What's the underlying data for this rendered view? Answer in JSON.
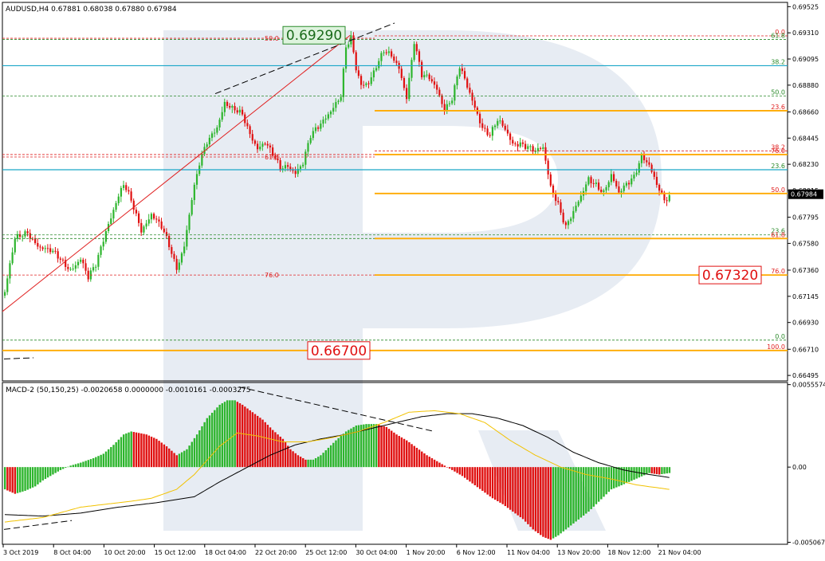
{
  "header": {
    "symbol_info": "AUDUSD,H4  0.67881 0.68038 0.67880 0.67984"
  },
  "macd_header": {
    "label": "MACD-2 (50,150,25) -0.0020658 0.0000000 -0.0010161 -0.0003275"
  },
  "colors": {
    "bull": "#2db52d",
    "bear": "#e01010",
    "fibo_red": "#e02020",
    "fibo_green": "#2a8a2a",
    "cyan": "#1aa6c8",
    "orange": "#ffaa00",
    "watermark": "#e7ecf3",
    "grid": "#000000",
    "macd_signal": "#000000",
    "macd_yellow": "#f2c200",
    "label_green_bg": "#ddf3dd",
    "label_green_border": "#2a8a2a",
    "label_red_bg": "#ffffff",
    "label_red_border": "#e01010"
  },
  "chart_data": [
    {
      "type": "candlestick",
      "symbol": "AUDUSD",
      "timeframe": "H4",
      "ohlc_header": {
        "open": 0.67881,
        "high": 0.68038,
        "low": 0.6788,
        "close": 0.67984
      },
      "current_price": 0.67984,
      "y_range": [
        0.6645,
        0.6956
      ],
      "y_ticks": [
        0.69525,
        0.6931,
        0.69095,
        0.6888,
        0.6866,
        0.68445,
        0.6823,
        0.68015,
        0.67795,
        0.6758,
        0.6736,
        0.67145,
        0.6693,
        0.6671,
        0.66495
      ],
      "x_ticks": [
        "3 Oct 2019",
        "8 Oct 04:00",
        "10 Oct 20:00",
        "15 Oct 12:00",
        "18 Oct 04:00",
        "22 Oct 20:00",
        "25 Oct 12:00",
        "30 Oct 04:00",
        "1 Nov 20:00",
        "6 Nov 12:00",
        "11 Nov 04:00",
        "13 Nov 20:00",
        "18 Nov 12:00",
        "21 Nov 04:00"
      ],
      "close_path": [
        [
          0,
          0.6718
        ],
        [
          4,
          0.676
        ],
        [
          9,
          0.6768
        ],
        [
          14,
          0.6755
        ],
        [
          20,
          0.6748
        ],
        [
          26,
          0.6738
        ],
        [
          30,
          0.6745
        ],
        [
          33,
          0.6728
        ],
        [
          36,
          0.674
        ],
        [
          40,
          0.677
        ],
        [
          44,
          0.6792
        ],
        [
          47,
          0.6805
        ],
        [
          50,
          0.6792
        ],
        [
          54,
          0.677
        ],
        [
          58,
          0.6783
        ],
        [
          62,
          0.677
        ],
        [
          65,
          0.6755
        ],
        [
          68,
          0.6738
        ],
        [
          71,
          0.6758
        ],
        [
          74,
          0.6795
        ],
        [
          77,
          0.6822
        ],
        [
          80,
          0.684
        ],
        [
          84,
          0.6855
        ],
        [
          87,
          0.6875
        ],
        [
          90,
          0.6868
        ],
        [
          94,
          0.6862
        ],
        [
          97,
          0.6848
        ],
        [
          100,
          0.6838
        ],
        [
          103,
          0.6842
        ],
        [
          106,
          0.683
        ],
        [
          109,
          0.6818
        ],
        [
          112,
          0.6822
        ],
        [
          115,
          0.6818
        ],
        [
          118,
          0.6825
        ],
        [
          121,
          0.6845
        ],
        [
          124,
          0.6852
        ],
        [
          127,
          0.6862
        ],
        [
          130,
          0.6872
        ],
        [
          133,
          0.688
        ],
        [
          135,
          0.6918
        ],
        [
          137,
          0.6925
        ],
        [
          139,
          0.69
        ],
        [
          141,
          0.6888
        ],
        [
          144,
          0.6892
        ],
        [
          147,
          0.6905
        ],
        [
          150,
          0.6915
        ],
        [
          153,
          0.691
        ],
        [
          156,
          0.6902
        ],
        [
          159,
          0.688
        ],
        [
          162,
          0.6925
        ],
        [
          165,
          0.6895
        ],
        [
          168,
          0.6892
        ],
        [
          171,
          0.6885
        ],
        [
          174,
          0.687
        ],
        [
          177,
          0.6878
        ],
        [
          180,
          0.6902
        ],
        [
          183,
          0.6885
        ],
        [
          186,
          0.687
        ],
        [
          189,
          0.6855
        ],
        [
          192,
          0.6848
        ],
        [
          195,
          0.6858
        ],
        [
          198,
          0.685
        ],
        [
          201,
          0.684
        ],
        [
          204,
          0.6842
        ],
        [
          207,
          0.6838
        ],
        [
          210,
          0.6832
        ],
        [
          213,
          0.6835
        ],
        [
          216,
          0.6805
        ],
        [
          219,
          0.6792
        ],
        [
          222,
          0.6772
        ],
        [
          225,
          0.6782
        ],
        [
          228,
          0.6795
        ],
        [
          231,
          0.6812
        ],
        [
          234,
          0.6808
        ],
        [
          237,
          0.68
        ],
        [
          240,
          0.6812
        ],
        [
          243,
          0.6798
        ],
        [
          246,
          0.6808
        ],
        [
          249,
          0.6815
        ],
        [
          252,
          0.683
        ],
        [
          255,
          0.682
        ],
        [
          258,
          0.6805
        ],
        [
          261,
          0.6795
        ],
        [
          263,
          0.6798
        ]
      ]
    },
    {
      "type": "fibonacci_levels",
      "fan_upper_left": [
        {
          "label": "50.0",
          "price": 0.69265,
          "color": "red",
          "style": "dashed"
        },
        {
          "label": "61.8",
          "price": 0.6829,
          "color": "red",
          "style": "dashed"
        },
        {
          "label": "76.0",
          "price": 0.6732,
          "color": "red",
          "style": "dashed"
        }
      ],
      "right_side": [
        {
          "label": "0.0",
          "price": 0.69285,
          "color": "red",
          "style": "dashed"
        },
        {
          "label": "61.8",
          "price": 0.69255,
          "color": "green",
          "style": "dashed"
        },
        {
          "label": "38.2",
          "price": 0.6904,
          "color": "green",
          "style": "solid-cyan"
        },
        {
          "label": "50.0",
          "price": 0.6879,
          "color": "green",
          "style": "dashed"
        },
        {
          "label": "23.6",
          "price": 0.6867,
          "color": "red",
          "style": "solid-orange"
        },
        {
          "label": "38.2",
          "price": 0.6834,
          "color": "red",
          "style": "dashed"
        },
        {
          "label": "76.0",
          "price": 0.6831,
          "color": "red",
          "style": "solid-orange"
        },
        {
          "label": "23.6",
          "price": 0.68185,
          "color": "green",
          "style": "solid-cyan"
        },
        {
          "label": "50.0",
          "price": 0.6799,
          "color": "red",
          "style": "solid-orange"
        },
        {
          "label": "23.6",
          "price": 0.6765,
          "color": "green",
          "style": "dashed"
        },
        {
          "label": "61.8",
          "price": 0.6762,
          "color": "red",
          "style": "solid-orange"
        },
        {
          "label": "76.0",
          "price": 0.6732,
          "color": "red",
          "style": "solid-orange"
        },
        {
          "label": "0.0",
          "price": 0.66785,
          "color": "green",
          "style": "dashed"
        },
        {
          "label": "100.0",
          "price": 0.667,
          "color": "red",
          "style": "solid-orange"
        }
      ],
      "price_labels": [
        {
          "text": "0.69290",
          "price": 0.6929,
          "style": "green"
        },
        {
          "text": "0.67320",
          "price": 0.6732,
          "style": "red"
        },
        {
          "text": "0.66700",
          "price": 0.667,
          "style": "red"
        }
      ],
      "current_label": "0.67984"
    },
    {
      "type": "macd_histogram",
      "y_range": [
        -0.0052,
        0.0057
      ],
      "y_ticks": [
        0.0055574,
        0.0,
        -0.005067
      ],
      "y_tick_labels": [
        "0.0055574",
        "0.00",
        "-0.005067"
      ],
      "histogram_path": [
        [
          0,
          -0.0015
        ],
        [
          4,
          -0.0018
        ],
        [
          8,
          -0.0016
        ],
        [
          12,
          -0.0013
        ],
        [
          15,
          -0.0009
        ],
        [
          19,
          -0.0005
        ],
        [
          22,
          -0.0002
        ],
        [
          26,
          0.0001
        ],
        [
          30,
          0.0003
        ],
        [
          35,
          0.0006
        ],
        [
          39,
          0.0009
        ],
        [
          43,
          0.0015
        ],
        [
          47,
          0.0022
        ],
        [
          50,
          0.0024
        ],
        [
          53,
          0.0023
        ],
        [
          56,
          0.0022
        ],
        [
          60,
          0.0019
        ],
        [
          64,
          0.0014
        ],
        [
          68,
          0.0008
        ],
        [
          72,
          0.0012
        ],
        [
          76,
          0.0022
        ],
        [
          80,
          0.0033
        ],
        [
          85,
          0.0042
        ],
        [
          88,
          0.0045
        ],
        [
          91,
          0.0045
        ],
        [
          94,
          0.0042
        ],
        [
          98,
          0.0037
        ],
        [
          102,
          0.0032
        ],
        [
          106,
          0.0025
        ],
        [
          110,
          0.0019
        ],
        [
          113,
          0.0012
        ],
        [
          116,
          0.0008
        ],
        [
          119,
          0.0005
        ],
        [
          122,
          0.0005
        ],
        [
          125,
          0.0008
        ],
        [
          128,
          0.0013
        ],
        [
          131,
          0.0018
        ],
        [
          135,
          0.0024
        ],
        [
          139,
          0.0028
        ],
        [
          143,
          0.0029
        ],
        [
          147,
          0.0029
        ],
        [
          151,
          0.0027
        ],
        [
          155,
          0.0022
        ],
        [
          159,
          0.0018
        ],
        [
          163,
          0.0013
        ],
        [
          167,
          0.0008
        ],
        [
          171,
          0.0004
        ],
        [
          174,
          0.0001
        ],
        [
          177,
          -0.0002
        ],
        [
          181,
          -0.0006
        ],
        [
          185,
          -0.0011
        ],
        [
          189,
          -0.0016
        ],
        [
          193,
          -0.0021
        ],
        [
          197,
          -0.0025
        ],
        [
          201,
          -0.003
        ],
        [
          205,
          -0.0035
        ],
        [
          209,
          -0.0042
        ],
        [
          213,
          -0.0047
        ],
        [
          216,
          -0.0049
        ],
        [
          219,
          -0.0046
        ],
        [
          222,
          -0.0042
        ],
        [
          225,
          -0.0038
        ],
        [
          228,
          -0.0034
        ],
        [
          231,
          -0.003
        ],
        [
          234,
          -0.0025
        ],
        [
          237,
          -0.002
        ],
        [
          240,
          -0.0015
        ],
        [
          243,
          -0.0013
        ],
        [
          247,
          -0.001
        ],
        [
          251,
          -0.0007
        ],
        [
          255,
          -0.0004
        ],
        [
          259,
          -0.0005
        ],
        [
          263,
          -0.0004
        ]
      ],
      "signal_path": [
        [
          0,
          -0.0032
        ],
        [
          15,
          -0.0033
        ],
        [
          30,
          -0.0031
        ],
        [
          45,
          -0.0027
        ],
        [
          60,
          -0.0024
        ],
        [
          75,
          -0.002
        ],
        [
          85,
          -0.001
        ],
        [
          95,
          -0.0001
        ],
        [
          105,
          0.0008
        ],
        [
          115,
          0.0015
        ],
        [
          125,
          0.0019
        ],
        [
          135,
          0.0022
        ],
        [
          145,
          0.0026
        ],
        [
          155,
          0.003
        ],
        [
          165,
          0.0034
        ],
        [
          175,
          0.0036
        ],
        [
          185,
          0.0036
        ],
        [
          195,
          0.0033
        ],
        [
          205,
          0.0028
        ],
        [
          215,
          0.002
        ],
        [
          225,
          0.001
        ],
        [
          235,
          0.0003
        ],
        [
          245,
          -0.0002
        ],
        [
          255,
          -0.0005
        ],
        [
          263,
          -0.0007
        ]
      ],
      "yellow_path": [
        [
          0,
          -0.0037
        ],
        [
          15,
          -0.0034
        ],
        [
          30,
          -0.0027
        ],
        [
          40,
          -0.0025
        ],
        [
          50,
          -0.0023
        ],
        [
          58,
          -0.0021
        ],
        [
          68,
          -0.0015
        ],
        [
          75,
          -0.0005
        ],
        [
          85,
          0.0014
        ],
        [
          92,
          0.0023
        ],
        [
          100,
          0.0021
        ],
        [
          110,
          0.0017
        ],
        [
          120,
          0.0017
        ],
        [
          130,
          0.002
        ],
        [
          140,
          0.0024
        ],
        [
          150,
          0.003
        ],
        [
          160,
          0.0037
        ],
        [
          170,
          0.0038
        ],
        [
          180,
          0.0036
        ],
        [
          190,
          0.003
        ],
        [
          200,
          0.0018
        ],
        [
          210,
          0.0008
        ],
        [
          220,
          0.0
        ],
        [
          230,
          -0.0005
        ],
        [
          240,
          -0.0008
        ],
        [
          250,
          -0.0012
        ],
        [
          263,
          -0.0015
        ]
      ]
    }
  ]
}
